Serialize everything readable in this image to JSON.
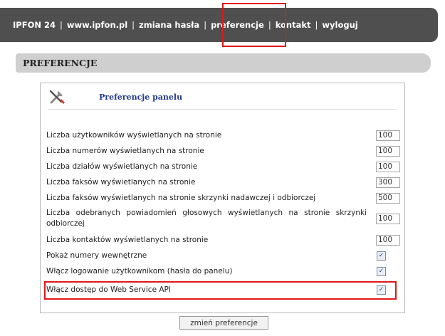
{
  "nav": {
    "brand": "IPFON 24",
    "site": "www.ipfon.pl",
    "change_password": "zmiana hasła",
    "preferences": "preferencje",
    "contact": "kontakt",
    "logout": "wyloguj",
    "separator": "|"
  },
  "section": {
    "title": "PREFERENCJE"
  },
  "panel": {
    "icon": "tools-icon",
    "title": "Preferencje panelu",
    "numeric_settings": [
      {
        "label": "Liczba użytkowników wyświetlanych na stronie",
        "value": "100"
      },
      {
        "label": "Liczba numerów wyświetlanych na stronie",
        "value": "100"
      },
      {
        "label": "Liczba działów wyświetlanych na stronie",
        "value": "100"
      },
      {
        "label": "Liczba faksów wyświetlanych na stronie",
        "value": "300"
      },
      {
        "label": "Liczba faksów wyświetlanych na stronie skrzynki nadawczej i odbiorczej",
        "value": "500"
      },
      {
        "label": "Liczba odebranych powiadomień głosowych wyświetlanych na stronie skrzynki odbiorczej",
        "value": "100"
      },
      {
        "label": "Liczba kontaktów wyświetlanych na stronie",
        "value": "100"
      }
    ],
    "checkbox_settings": [
      {
        "label": "Pokaż numery wewnętrzne",
        "checked": true
      },
      {
        "label": "Włącz logowanie użytkownikom (hasła do panelu)",
        "checked": true
      },
      {
        "label": "Włącz dostęp do Web Service API",
        "checked": true
      }
    ],
    "check_mark": "✓"
  },
  "submit_label": "zmień preferencje",
  "colors": {
    "topbar": "#4f4f4f",
    "header": "#cfcfcf",
    "title": "#233a8f",
    "highlight": "#e01818"
  }
}
